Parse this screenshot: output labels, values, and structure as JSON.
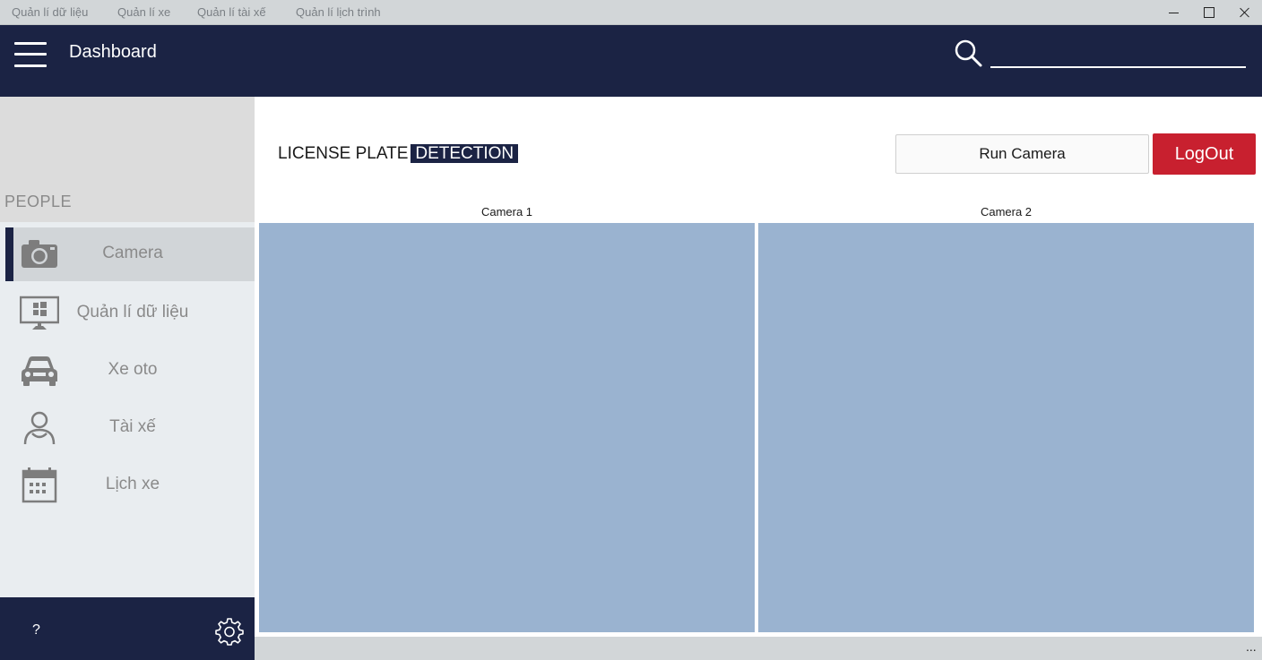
{
  "menu": {
    "items": [
      "Quản lí dữ liệu",
      "Quản lí xe",
      "Quản lí tài xế",
      "Quản lí lịch trình"
    ]
  },
  "header": {
    "title": "Dashboard",
    "search_value": ""
  },
  "sidebar": {
    "section_label": "PEOPLE",
    "items": [
      {
        "label": "Camera",
        "icon": "camera-icon",
        "active": true
      },
      {
        "label": "Quản lí dữ liệu",
        "icon": "monitor-icon",
        "active": false
      },
      {
        "label": "Xe oto",
        "icon": "car-icon",
        "active": false
      },
      {
        "label": "Tài xế",
        "icon": "user-icon",
        "active": false
      },
      {
        "label": "Lịch xe",
        "icon": "calendar-icon",
        "active": false
      }
    ],
    "help_label": "?"
  },
  "main": {
    "title_part1": "LICENSE PLATE",
    "title_part2": "DETECTION",
    "run_camera_label": "Run Camera",
    "logout_label": "LogOut",
    "cameras": [
      "Camera 1",
      "Camera 2"
    ]
  },
  "status": {
    "more_label": "..."
  },
  "colors": {
    "header_bg": "#1b2344",
    "logout_bg": "#c8202f",
    "camera_view_bg": "#9ab3d0",
    "sidebar_bg": "#e9edf0"
  }
}
